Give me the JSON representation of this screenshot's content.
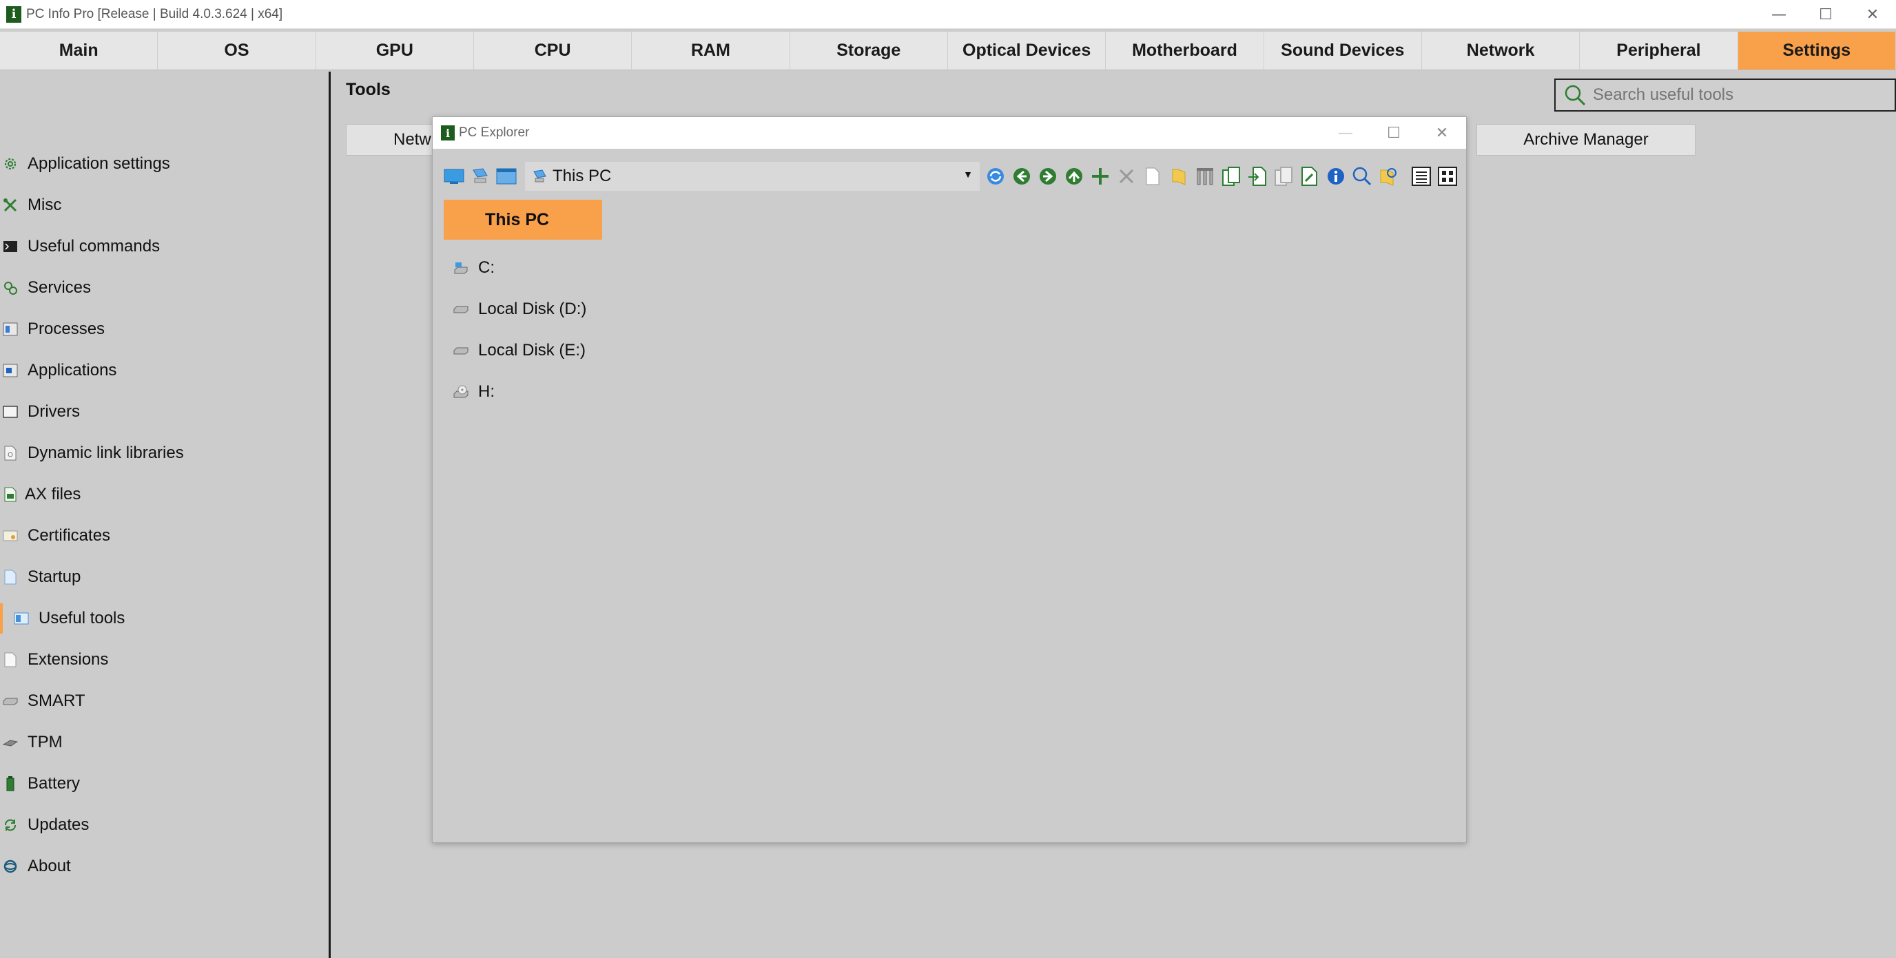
{
  "window": {
    "title": "PC Info Pro [Release | Build 4.0.3.624 | x64]",
    "app_icon_glyph": "i",
    "controls": [
      "minimize-icon",
      "maximize-icon",
      "close-icon"
    ]
  },
  "tabs": [
    {
      "label": "Main"
    },
    {
      "label": "OS"
    },
    {
      "label": "GPU"
    },
    {
      "label": "CPU"
    },
    {
      "label": "RAM"
    },
    {
      "label": "Storage"
    },
    {
      "label": "Optical Devices"
    },
    {
      "label": "Motherboard"
    },
    {
      "label": "Sound Devices"
    },
    {
      "label": "Network"
    },
    {
      "label": "Peripheral"
    },
    {
      "label": "Settings"
    }
  ],
  "active_tab": "Settings",
  "accent_color": "#f9a04b",
  "sidebar": {
    "items": [
      {
        "label": "Application settings",
        "icon": "gear-icon"
      },
      {
        "label": "Misc",
        "icon": "tools-icon"
      },
      {
        "label": "Useful commands",
        "icon": "terminal-icon"
      },
      {
        "label": "Services",
        "icon": "services-icon"
      },
      {
        "label": "Processes",
        "icon": "processes-icon"
      },
      {
        "label": "Applications",
        "icon": "applications-icon"
      },
      {
        "label": "Drivers",
        "icon": "drivers-icon"
      },
      {
        "label": "Dynamic link libraries",
        "icon": "dll-icon"
      },
      {
        "label": "AX files",
        "icon": "ax-file-icon"
      },
      {
        "label": "Certificates",
        "icon": "certificate-icon"
      },
      {
        "label": "Startup",
        "icon": "startup-icon"
      },
      {
        "label": "Useful tools",
        "icon": "useful-tools-icon"
      },
      {
        "label": "Extensions",
        "icon": "extensions-icon"
      },
      {
        "label": "SMART",
        "icon": "disk-icon"
      },
      {
        "label": "TPM",
        "icon": "tpm-icon"
      },
      {
        "label": "Battery",
        "icon": "battery-icon"
      },
      {
        "label": "Updates",
        "icon": "refresh-icon"
      },
      {
        "label": "About",
        "icon": "about-icon"
      }
    ],
    "active_item": "Useful tools"
  },
  "main": {
    "title": "Tools",
    "search": {
      "placeholder": "Search useful tools",
      "value": ""
    },
    "tool_buttons": [
      {
        "label": "Netw"
      },
      {
        "label": "Archive Manager"
      }
    ]
  },
  "explorer": {
    "title": "PC Explorer",
    "app_icon_glyph": "i",
    "path": "This PC",
    "breadcrumb": "This PC",
    "toolbar_icons": [
      "computer-icon",
      "network-icon",
      "window-icon",
      "refresh-icon",
      "back-icon",
      "forward-icon",
      "up-icon",
      "add-icon",
      "delete-icon",
      "new-file-icon",
      "new-folder-icon",
      "filter-icon",
      "copy-icon",
      "paste-into-icon",
      "clipboard-icon",
      "edit-icon",
      "info-icon",
      "search-icon",
      "folder-search-icon",
      "list-view-icon",
      "grid-view-icon"
    ],
    "drives": [
      {
        "label": "C:",
        "icon": "system-drive-icon"
      },
      {
        "label": "Local Disk (D:)",
        "icon": "disk-drive-icon"
      },
      {
        "label": "Local Disk (E:)",
        "icon": "disk-drive-icon"
      },
      {
        "label": "H:",
        "icon": "optical-drive-icon"
      }
    ]
  }
}
